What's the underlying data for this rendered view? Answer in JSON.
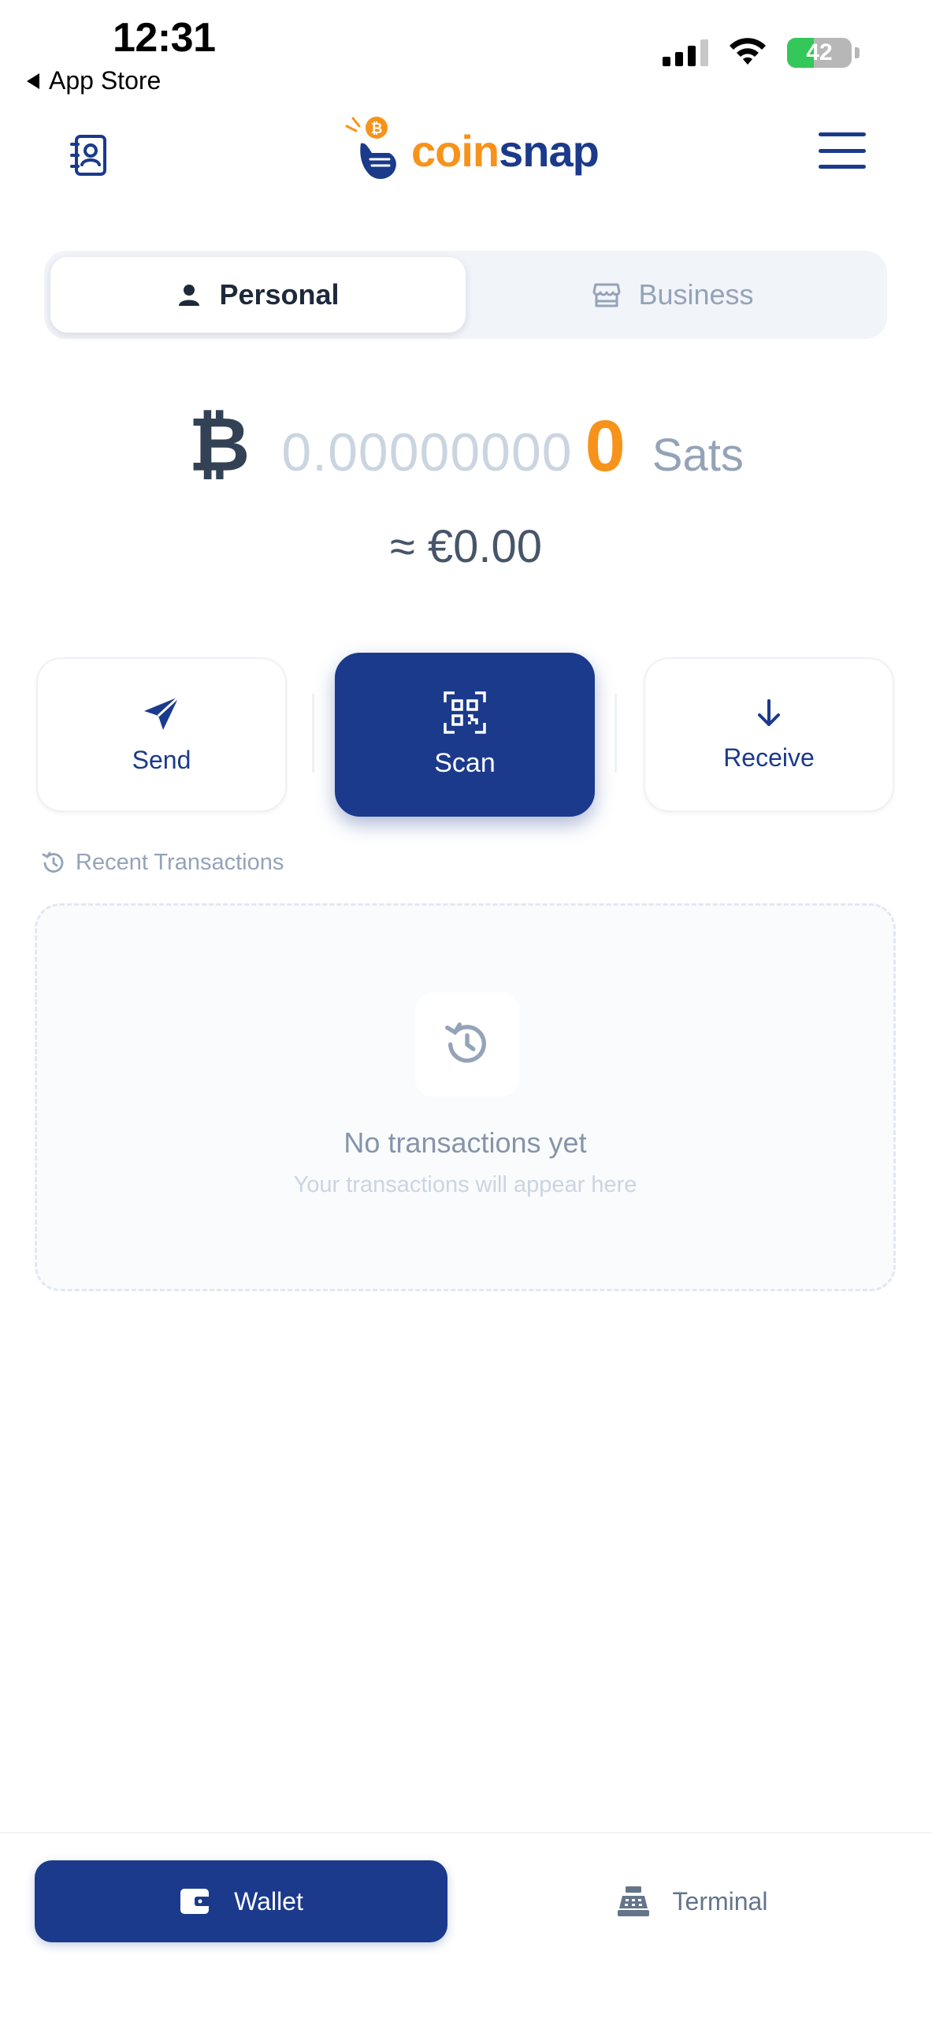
{
  "status_bar": {
    "time": "12:31",
    "back_app": "App Store",
    "battery": "42"
  },
  "header": {
    "logo_part1": "coin",
    "logo_part2": "snap",
    "contacts_icon": "contacts-book-icon",
    "menu_icon": "hamburger-menu-icon"
  },
  "mode_toggle": {
    "personal": "Personal",
    "business": "Business"
  },
  "balance": {
    "btc_symbol": "₿",
    "btc_amount": "0.00000000",
    "sats_amount": "0",
    "sats_unit": "Sats",
    "fiat": "≈ €0.00"
  },
  "actions": {
    "send": "Send",
    "scan": "Scan",
    "receive": "Receive"
  },
  "recent": {
    "label": "Recent Transactions",
    "empty_title": "No transactions yet",
    "empty_subtitle": "Your transactions will appear here"
  },
  "bottom_nav": {
    "wallet": "Wallet",
    "terminal": "Terminal"
  },
  "colors": {
    "brand_blue": "#1b3a8c",
    "bitcoin_orange": "#f7931a"
  }
}
